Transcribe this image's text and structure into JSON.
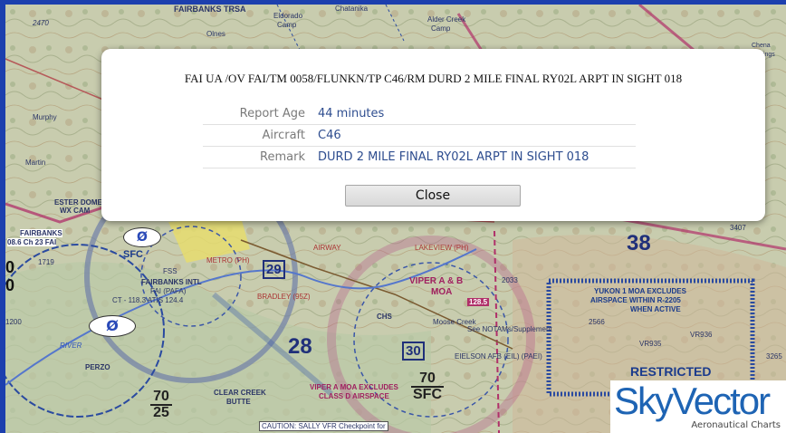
{
  "report": {
    "raw_text": "FAI UA /OV FAI/TM 0058/FLUNKN/TP C46/RM DURD 2 MILE FINAL RY02L ARPT IN SIGHT 018",
    "fields": [
      {
        "label": "Report Age",
        "value": "44 minutes"
      },
      {
        "label": "Aircraft",
        "value": "C46"
      },
      {
        "label": "Remark",
        "value": "DURD 2 MILE FINAL RY02L ARPT IN SIGHT 018"
      }
    ],
    "close_label": "Close"
  },
  "logo": {
    "brand": "SkyVector",
    "tagline": "Aeronautical Charts"
  },
  "map": {
    "labels": {
      "fairbanks_trsa": "FAIRBANKS TRSA",
      "eldorado": "Eldorado",
      "camp": "Camp",
      "olnes": "Olnes",
      "chatanika": "Chatanika",
      "alder_creek": "Alder Creek",
      "camp2": "Camp",
      "n2470": "2470",
      "murphy": "Murphy",
      "martin": "Martin",
      "ester_dome": "ESTER DOME",
      "wx_cam": "WX CAM",
      "fairbanks": "FAIRBANKS",
      "freq": "08.6 Ch 23 FAI",
      "sfc": "SFC",
      "fss": "FSS",
      "fairbanks_intl": "FAIRBANKS INTL",
      "fai_pafa": "FAI (PAFA)",
      "ct_atis": "CT - 118.3 ATIS 124.4",
      "metro": "METRO (PH)",
      "bradley": "BRADLEY (95Z)",
      "airway": "AIRWAY",
      "lakeview": "LAKEVIEW (PH)",
      "viper_a_b": "VIPER A & B",
      "moa": "MOA",
      "n128_5": "128.5",
      "n2033": "2033",
      "see_notams": "See NOTAMs/Supplement",
      "eielson": "EIELSON AFB (EIL) (PAEI)",
      "moose_creek": "Moose Creek",
      "perzo": "PERZO",
      "river": "RIVER",
      "clear_creek": "CLEAR CREEK",
      "butte": "BUTTE",
      "viper_excludes": "VIPER A MOA EXCLUDES",
      "class_d": "CLASS D AIRSPACE",
      "caution": "CAUTION: SALLY VFR Checkpoint for",
      "yukon": "YUKON 1 MOA EXCLUDES",
      "airspace_within": "AIRSPACE WITHIN R-2205",
      "when_active": "WHEN ACTIVE",
      "restricted": "RESTRICTED",
      "vr935": "VR935",
      "vr936": "VR936",
      "n3407": "3407",
      "n3265": "3265",
      "n2566": "2566",
      "n1719": "1719",
      "n1200": "1200",
      "chena": "Chena",
      "springs": "Springs",
      "chs": "CHS"
    },
    "big_numbers": {
      "n38": "38",
      "n28": "28",
      "n29": "29",
      "n30": "30",
      "n0a": "0",
      "n0b": "0"
    },
    "fractions": [
      {
        "top": "70",
        "bottom": "25"
      },
      {
        "top": "70",
        "bottom": "SFC"
      }
    ],
    "no_sign": "Ø",
    "colors": {
      "magenta": "#b0306a",
      "chart_blue": "#1b3b8c",
      "terrain": "#c9cdb0"
    }
  }
}
